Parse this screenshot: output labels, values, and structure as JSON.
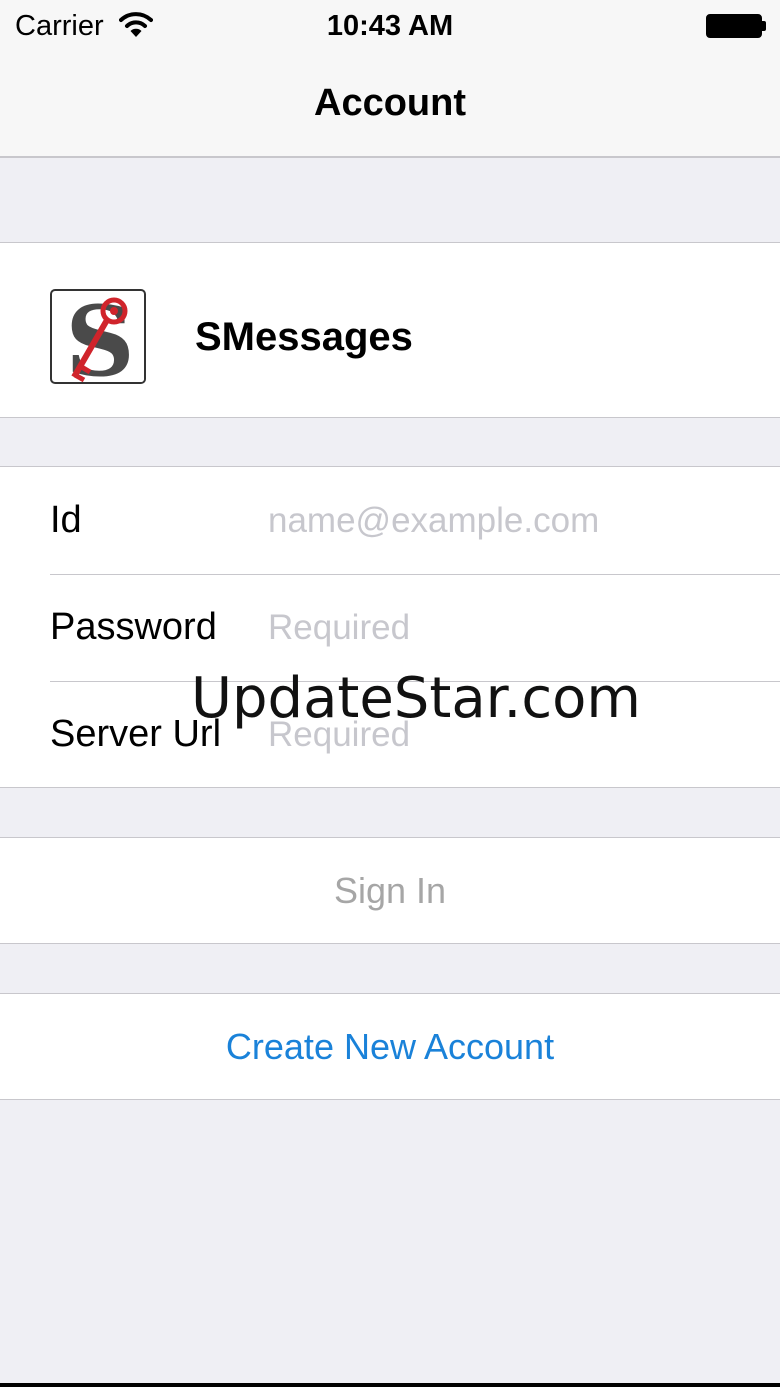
{
  "status_bar": {
    "carrier": "Carrier",
    "time": "10:43 AM"
  },
  "nav": {
    "title": "Account"
  },
  "app": {
    "name": "SMessages",
    "logo_letter": "S",
    "logo_key_color": "#d0242b"
  },
  "form": {
    "fields": [
      {
        "label": "Id",
        "placeholder": "name@example.com",
        "value": ""
      },
      {
        "label": "Password",
        "placeholder": "Required",
        "value": ""
      },
      {
        "label": "Server Url",
        "placeholder": "Required",
        "value": ""
      }
    ]
  },
  "buttons": {
    "sign_in": "Sign In",
    "create_account": "Create New Account"
  },
  "watermark": "UpdateStar.com",
  "colors": {
    "accent": "#1a82d9",
    "disabled": "#a6a6a6",
    "background": "#efeff4"
  }
}
